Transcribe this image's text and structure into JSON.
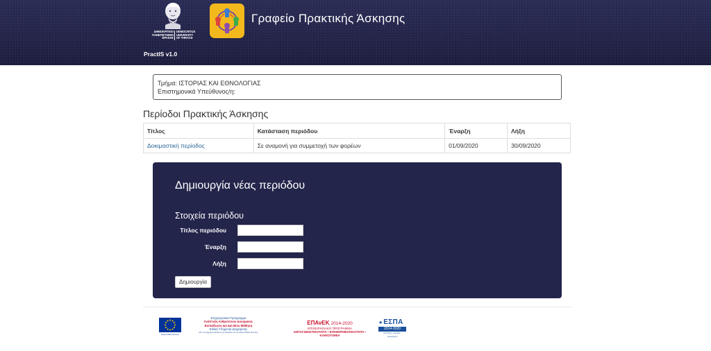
{
  "header": {
    "university": {
      "name_gr": [
        "ΔΗΜΟΚΡΙΤΕΙΟ",
        "ΠΑΝΕΠΙΣΤΗΜΙΟ",
        "ΘΡΑΚΗΣ"
      ],
      "name_en": [
        "DEMOCRITUS",
        "UNIVERSITY",
        "OF THRACE"
      ]
    },
    "office_title": "Γραφείο Πρακτικής Άσκησης",
    "version": "PractIS v1.0"
  },
  "info": {
    "department": "Τμήμα: ΙΣΤΟΡΙΑΣ ΚΑΙ ΕΘΝΟΛΟΓΙΑΣ",
    "supervisor": "Επιστημονικά Υπεύθυνος/η:"
  },
  "periods": {
    "title": "Περίοδοι Πρακτικής Άσκησης",
    "columns": [
      "Τίτλος",
      "Κατάσταση περιόδου",
      "Έναρξη",
      "Λήξη"
    ],
    "rows": [
      {
        "title": "Δοκιμαστική περίοδος",
        "state": "Σε αναμονή για συμμετοχή των φορέων",
        "start": "01/09/2020",
        "end": "30/09/2020"
      }
    ]
  },
  "create_form": {
    "title": "Δημιουργία νέας περιόδου",
    "subtitle": "Στοιχεία περιόδου",
    "fields": [
      {
        "label": "Τίτλος περιόδου",
        "value": ""
      },
      {
        "label": "Έναρξη",
        "value": ""
      },
      {
        "label": "Λήξη",
        "value": ""
      }
    ],
    "submit_label": "Δημιουργία"
  },
  "footer": {
    "eu": {
      "caption": "Ευρωπαϊκή Ένωση"
    },
    "ep": {
      "lines": [
        "Επιχειρησιακό Πρόγραμμα",
        "Ανάπτυξη Ανθρώπινου Δυναμικού,",
        "Εκπαίδευση και Διά Βίου Μάθηση",
        "Ειδική Υπηρεσία Διαχείρισης",
        "Με τη συγχρηματοδότηση της Ελλάδας και της Ευρωπαϊκής Ένωσης"
      ]
    },
    "epanek": {
      "name": "ΕΠΑνΕΚ",
      "years": "2014-2020",
      "line1": "ΕΠΙΧΕΙΡΗΣΙΑΚΟ ΠΡΟΓΡΑΜΜΑ",
      "line2": "ΑΝΤΑΓΩΝΙΣΤΙΚΟΤΗΤΑ • ΕΠΙΧΕΙΡΗΜΑΤΙΚΟΤΗΤΑ • ΚΑΙΝΟΤΟΜΙΑ"
    },
    "espa": {
      "name": "ΕΣΠΑ",
      "years": "2014-2020",
      "note": "ανάπτυξη - εργασία - αλληλεγγύη"
    }
  },
  "colors": {
    "header_bg": "#232449",
    "panel_bg": "#24254b",
    "link": "#2a6496",
    "office_logo_bg": "#f2b81c"
  }
}
